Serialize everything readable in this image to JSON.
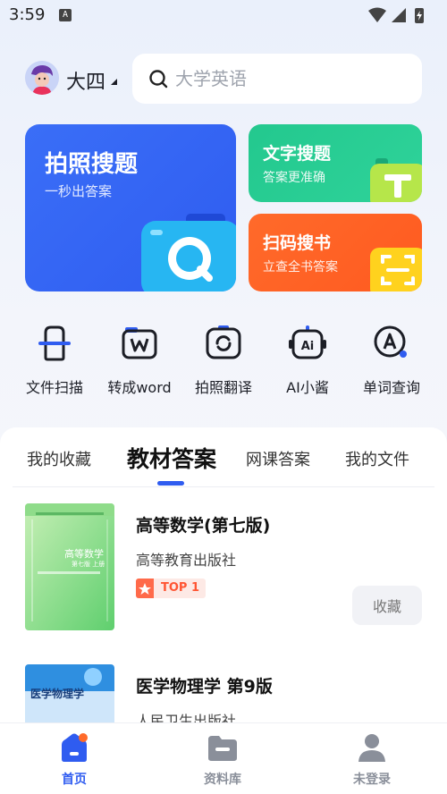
{
  "status_bar": {
    "time": "3:59",
    "notif_glyph": "A"
  },
  "header": {
    "grade": "大四",
    "search_placeholder": "大学英语"
  },
  "features": {
    "photo": {
      "title": "拍照搜题",
      "subtitle": "一秒出答案",
      "icon": "camera-search-icon"
    },
    "text": {
      "title": "文字搜题",
      "subtitle": "答案更准确",
      "icon": "text-t-icon"
    },
    "scan": {
      "title": "扫码搜书",
      "subtitle": "立查全书答案",
      "icon": "barcode-scan-icon"
    }
  },
  "tools": [
    {
      "label": "文件扫描",
      "icon": "file-scan-icon"
    },
    {
      "label": "转成word",
      "icon": "word-convert-icon"
    },
    {
      "label": "拍照翻译",
      "icon": "photo-translate-icon"
    },
    {
      "label": "AI小酱",
      "icon": "ai-assistant-icon"
    },
    {
      "label": "单词查询",
      "icon": "word-lookup-icon"
    }
  ],
  "tabs": [
    {
      "label": "我的收藏",
      "active": false
    },
    {
      "label": "教材答案",
      "active": true
    },
    {
      "label": "网课答案",
      "active": false
    },
    {
      "label": "我的文件",
      "active": false
    }
  ],
  "books": [
    {
      "title": "高等数学(第七版)",
      "publisher": "高等教育出版社",
      "rank": "TOP 1",
      "action": "收藏",
      "cover_text": "高等数学",
      "cover_sub": "第七版 上册"
    },
    {
      "title": "医学物理学 第9版",
      "publisher": "人民卫生出版社",
      "cover_text": "医学物理学"
    }
  ],
  "bottom_nav": [
    {
      "label": "首页",
      "active": true,
      "icon": "home-icon"
    },
    {
      "label": "资料库",
      "active": false,
      "icon": "folder-icon"
    },
    {
      "label": "未登录",
      "active": false,
      "icon": "user-icon"
    }
  ],
  "colors": {
    "primary": "#2f5cf0",
    "green": "#23c88e",
    "orange": "#ff5a20",
    "rank": "#ff5533"
  }
}
